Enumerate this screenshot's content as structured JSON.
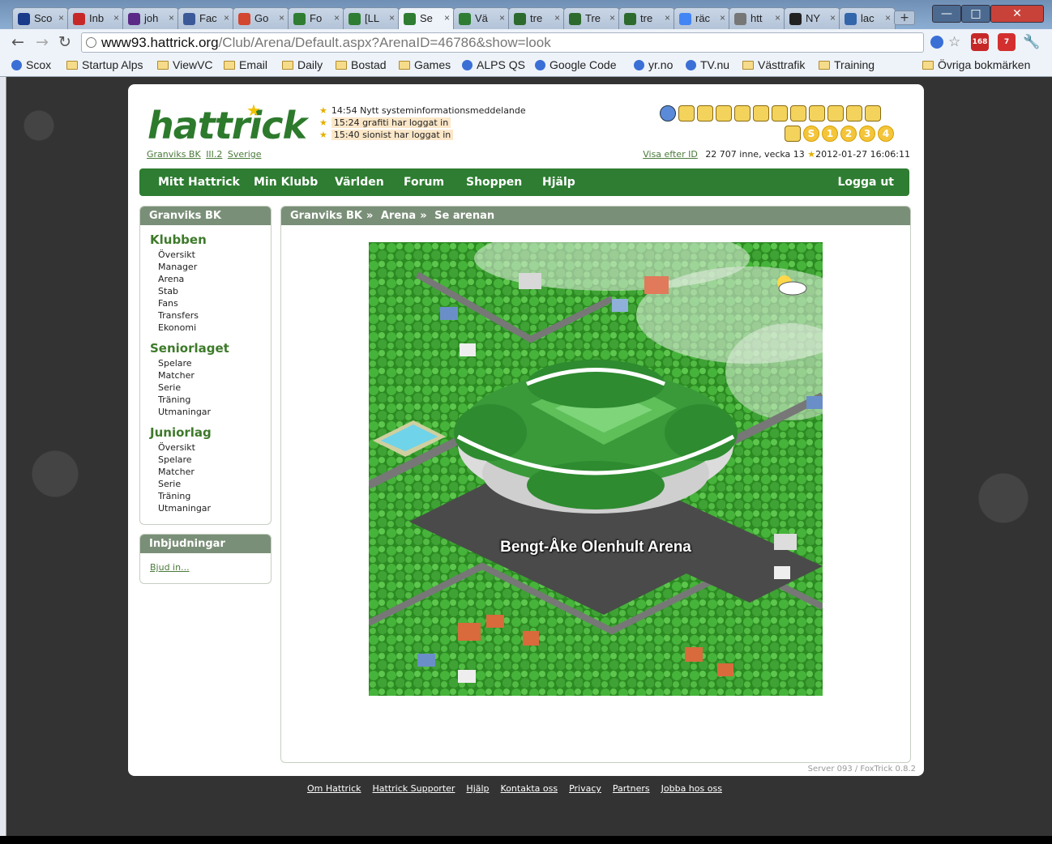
{
  "browser": {
    "tabs": [
      {
        "label": "Sco",
        "icon": "scox-icon",
        "color": "#1a3a8a"
      },
      {
        "label": "Inb",
        "icon": "gmail-icon",
        "color": "#c62828"
      },
      {
        "label": "joh",
        "icon": "yahoo-icon",
        "color": "#5b2a86"
      },
      {
        "label": "Fac",
        "icon": "facebook-icon",
        "color": "#3b5998"
      },
      {
        "label": "Go",
        "icon": "google-plus-icon",
        "color": "#d3462f"
      },
      {
        "label": "Fo",
        "icon": "hattrick-icon",
        "color": "#2e7d32"
      },
      {
        "label": "[LL",
        "icon": "hattrick-icon",
        "color": "#2e7d32"
      },
      {
        "label": "Se",
        "icon": "hattrick-icon",
        "color": "#2e7d32",
        "active": true
      },
      {
        "label": "Vä",
        "icon": "hattrick-icon",
        "color": "#2e7d32"
      },
      {
        "label": "tre",
        "icon": "tracker-icon",
        "color": "#2d6a2d"
      },
      {
        "label": "Tre",
        "icon": "tracker-icon",
        "color": "#2d6a2d"
      },
      {
        "label": "tre",
        "icon": "tracker-icon",
        "color": "#2d6a2d"
      },
      {
        "label": "räc",
        "icon": "google-icon",
        "color": "#4285f4"
      },
      {
        "label": "htt",
        "icon": "globe-icon",
        "color": "#777777"
      },
      {
        "label": "NY",
        "icon": "club-icon",
        "color": "#222222"
      },
      {
        "label": "lac",
        "icon": "page-icon",
        "color": "#3366aa"
      }
    ],
    "url_host": "www93.hattrick.org",
    "url_path": "/Club/Arena/Default.aspx?ArenaID=46786&show=look",
    "bookmarks": [
      {
        "label": "Scox",
        "type": "site"
      },
      {
        "label": "Startup Alps",
        "type": "folder"
      },
      {
        "label": "ViewVC",
        "type": "folder"
      },
      {
        "label": "Email",
        "type": "folder"
      },
      {
        "label": "Daily",
        "type": "folder"
      },
      {
        "label": "Bostad",
        "type": "folder"
      },
      {
        "label": "Games",
        "type": "folder"
      },
      {
        "label": "ALPS QS",
        "type": "site"
      },
      {
        "label": "Google Code",
        "type": "site"
      },
      {
        "label": "yr.no",
        "type": "site"
      },
      {
        "label": "TV.nu",
        "type": "site"
      },
      {
        "label": "Västtrafik",
        "type": "folder"
      },
      {
        "label": "Training",
        "type": "folder"
      }
    ],
    "other_bookmarks": "Övriga bokmärken",
    "badge_rss": "168",
    "badge_mail": "7"
  },
  "header": {
    "logo_text": "hattrick",
    "club_name": "Granviks BK",
    "league": "III.2",
    "country": "Sverige",
    "news": [
      {
        "text": "14:54 Nytt systeminformationsmeddelande",
        "highlight": false
      },
      {
        "text": "15:24 grafiti har loggat in",
        "highlight": true
      },
      {
        "text": "15:40 sionist har loggat in",
        "highlight": true
      }
    ],
    "view_by_id": "Visa efter ID",
    "online_info": "22 707 inne, vecka 13",
    "datetime": "2012-01-27 16:06:11",
    "icon_row_1": [
      "globe-icon",
      "chpp-icon",
      "star-box-icon",
      "bulb-icon",
      "mail-icon",
      "notes-icon",
      "chat-icon",
      "magnifier-icon",
      "s-icon",
      "target-icon",
      "g-icon",
      "tools-icon"
    ],
    "icon_row_2_numbers": [
      "S",
      "1",
      "2",
      "3",
      "4"
    ]
  },
  "nav": {
    "items": [
      "Mitt Hattrick",
      "Min Klubb",
      "Världen",
      "Forum",
      "Shoppen",
      "Hjälp"
    ],
    "logout": "Logga ut"
  },
  "sidebar": {
    "title": "Granviks BK",
    "sections": [
      {
        "title": "Klubben",
        "links": [
          "Översikt",
          "Manager",
          "Arena",
          "Stab",
          "Fans",
          "Transfers",
          "Ekonomi"
        ]
      },
      {
        "title": "Seniorlaget",
        "links": [
          "Spelare",
          "Matcher",
          "Serie",
          "Träning",
          "Utmaningar"
        ]
      },
      {
        "title": "Juniorlag",
        "links": [
          "Översikt",
          "Spelare",
          "Matcher",
          "Serie",
          "Träning",
          "Utmaningar"
        ]
      }
    ],
    "invites_title": "Inbjudningar",
    "invites_link": "Bjud in..."
  },
  "content": {
    "breadcrumb": [
      "Granviks BK",
      "Arena",
      "Se arenan"
    ],
    "arena_name": "Bengt-Åke Olenhult Arena"
  },
  "server_info": "Server 093 / FoxTrick 0.8.2",
  "footer_links": [
    "Om Hattrick",
    "Hattrick Supporter",
    "Hjälp",
    "Kontakta oss",
    "Privacy",
    "Partners",
    "Jobba hos oss"
  ],
  "colors": {
    "brand_green": "#2e7d32",
    "section_header": "#7a8f77",
    "highlight_news": "#fbe7c8"
  }
}
